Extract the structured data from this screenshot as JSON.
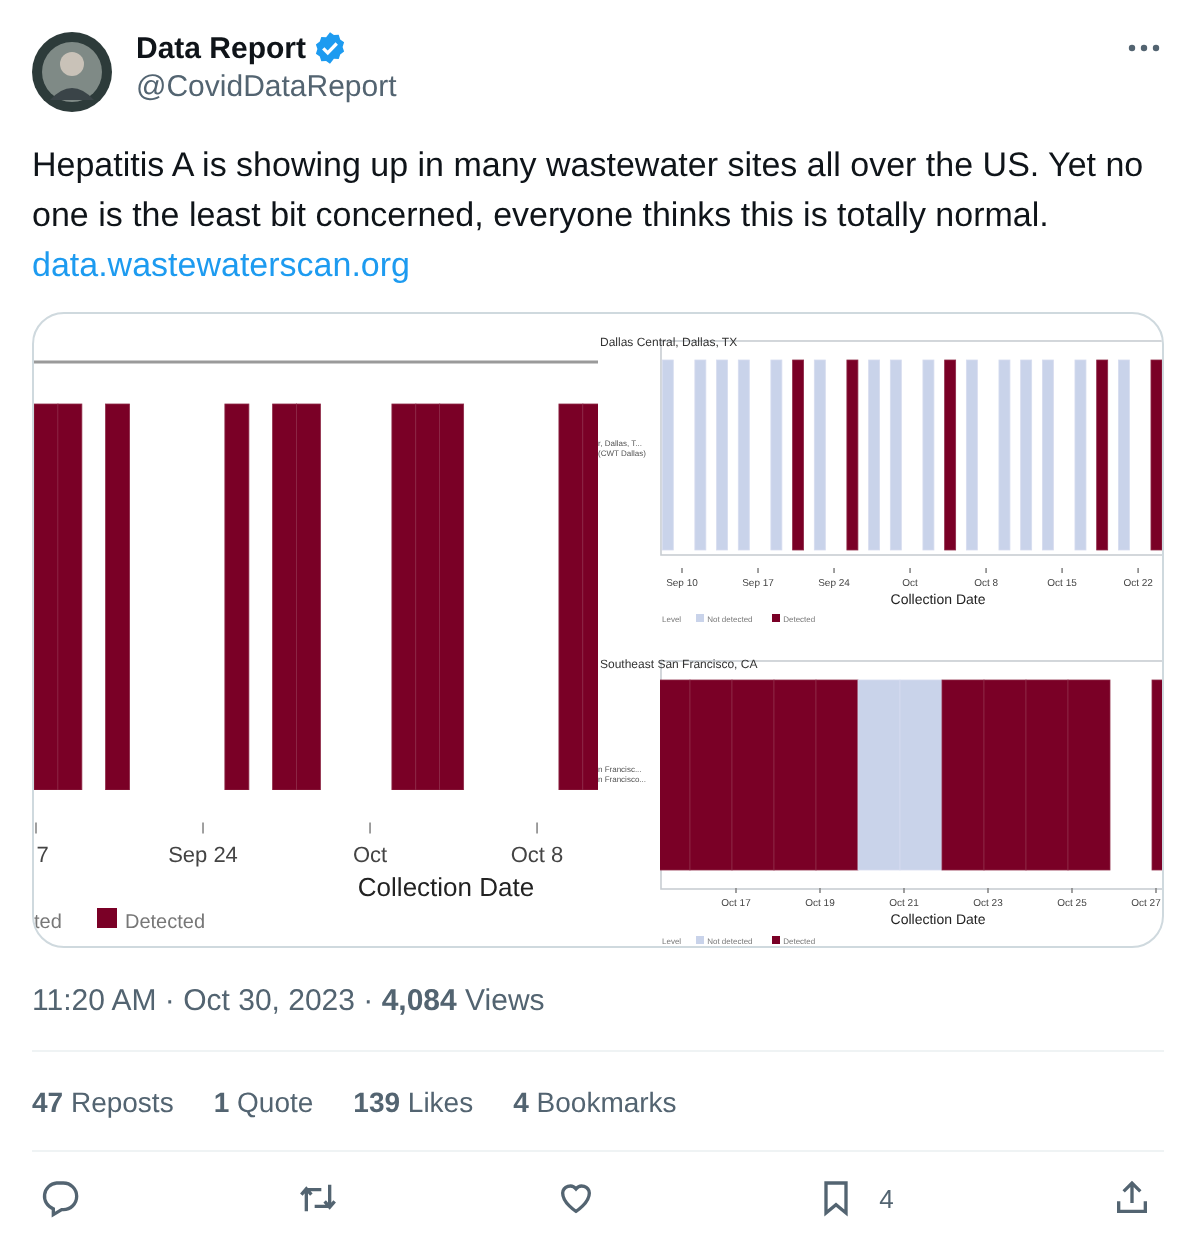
{
  "author": {
    "name": "Data Report",
    "handle": "@CovidDataReport",
    "verified": true
  },
  "text": "Hepatitis A is showing up in many wastewater sites all over the US. Yet no one is the least bit concerned, everyone thinks this is totally normal.",
  "link": "data.wastewaterscan.org",
  "charts": [
    {
      "ticks": [
        "7",
        "Sep 24",
        "Oct",
        "Oct 8"
      ],
      "samples": [
        {
          "detected": true
        },
        {
          "detected": true
        },
        {
          "detected": true
        },
        {
          "detected": true
        },
        {
          "detected": true
        },
        {
          "detected": true
        },
        {
          "detected": true
        },
        {
          "detected": true
        },
        {
          "detected": true
        },
        {
          "detected": true
        },
        {
          "detected": true
        }
      ],
      "xlabel": "Collection Date",
      "legend": [
        {
          "label": "ted",
          "kind": "label"
        },
        {
          "label": "Detected",
          "kind": "detected"
        }
      ]
    },
    {
      "title": "Dallas Central, Dallas, TX",
      "ylabels": [
        "r, Dallas, T...",
        "(CWT Dallas)"
      ],
      "ticks": [
        "Sep 10",
        "Sep 17",
        "Sep 24",
        "Oct",
        "Oct 8",
        "Oct 15",
        "Oct 22"
      ],
      "samples": [
        {
          "detected": false
        },
        {
          "detected": false
        },
        {
          "detected": false
        },
        {
          "detected": false
        },
        {
          "detected": false
        },
        {
          "detected": true
        },
        {
          "detected": false
        },
        {
          "detected": true
        },
        {
          "detected": false
        },
        {
          "detected": false
        },
        {
          "detected": false
        },
        {
          "detected": true
        },
        {
          "detected": false
        },
        {
          "detected": false
        },
        {
          "detected": false
        },
        {
          "detected": false
        },
        {
          "detected": false
        },
        {
          "detected": true
        },
        {
          "detected": false
        },
        {
          "detected": true
        }
      ],
      "xlabel": "Collection Date",
      "legend": [
        {
          "label": "Level",
          "kind": "label"
        },
        {
          "label": "Not detected",
          "kind": "not_detected"
        },
        {
          "label": "Detected",
          "kind": "detected"
        }
      ]
    },
    {
      "title": "Southeast San Francisco, CA",
      "ylabels": [
        "n Francisc...",
        "n Francisco..."
      ],
      "ticks": [
        "Oct 17",
        "Oct 19",
        "Oct 21",
        "Oct 23",
        "Oct 25",
        "Oct 27"
      ],
      "samples": [
        {
          "detected": true
        },
        {
          "detected": true
        },
        {
          "detected": true
        },
        {
          "detected": true
        },
        {
          "detected": true
        },
        {
          "detected": false
        },
        {
          "detected": false
        },
        {
          "detected": true
        },
        {
          "detected": true
        },
        {
          "detected": true
        },
        {
          "detected": true
        },
        {
          "detected": true
        }
      ],
      "xlabel": "Collection Date",
      "legend": [
        {
          "label": "Level",
          "kind": "label"
        },
        {
          "label": "Not detected",
          "kind": "not_detected"
        },
        {
          "label": "Detected",
          "kind": "detected"
        }
      ]
    }
  ],
  "timestamp": "11:20 AM · Oct 30, 2023 · **4,084** Views",
  "stats": [
    "**47** Reposts",
    "**1** Quote",
    "**139** Likes",
    "**4** Bookmarks"
  ],
  "actions": [
    {
      "kind": "reply"
    },
    {
      "kind": "repost"
    },
    {
      "kind": "like"
    },
    {
      "kind": "bookmark",
      "count": "4"
    },
    {
      "kind": "share"
    }
  ]
}
